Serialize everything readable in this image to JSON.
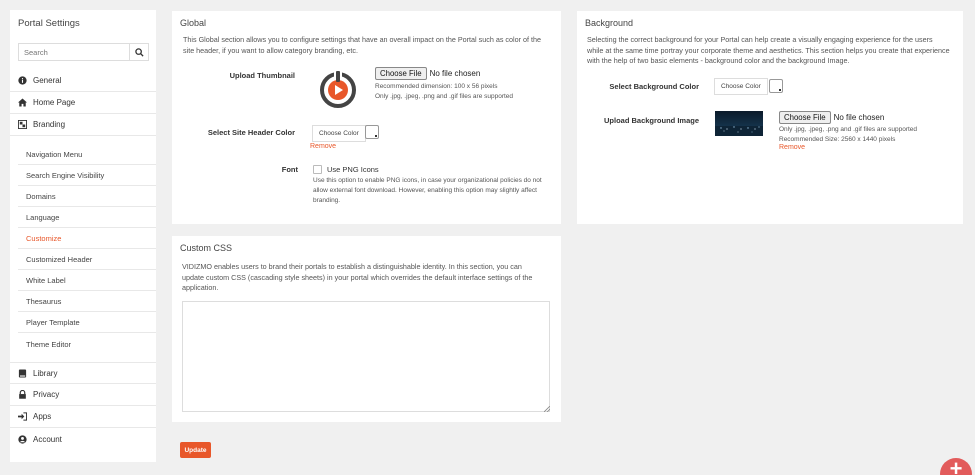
{
  "sidebar": {
    "title": "Portal Settings",
    "search_placeholder": "Search",
    "items": {
      "general": "General",
      "home_page": "Home Page",
      "branding": "Branding",
      "library": "Library",
      "privacy": "Privacy",
      "apps": "Apps",
      "account": "Account"
    },
    "branding_sub": {
      "navigation_menu": "Navigation Menu",
      "seo": "Search Engine Visibility",
      "domains": "Domains",
      "language": "Language",
      "customize": "Customize",
      "customized_header": "Customized Header",
      "white_label": "White Label",
      "thesaurus": "Thesaurus",
      "player_template": "Player Template",
      "theme_editor": "Theme Editor"
    },
    "active_item": "Customize"
  },
  "global": {
    "title": "Global",
    "desc_line1": "This Global section allows you to configure settings that have an overall impact on the Portal such as color of the",
    "desc_line2": "site header, if you want to allow category branding, etc.",
    "upload_thumbnail_label": "Upload Thumbnail",
    "choose_file": "Choose File",
    "no_file": "No file chosen",
    "thumb_hint1": "Recommended dimension: 100 x 56 pixels",
    "thumb_hint2": "Only .jpg, .jpeg, .png and .gif files are supported",
    "header_color_label": "Select Site Header Color",
    "choose_color": "Choose Color",
    "remove": "Remove",
    "font_label": "Font",
    "use_png_icons": "Use PNG Icons",
    "font_hint1": "Use this option to enable PNG icons, in case your organizational policies do not",
    "font_hint2": "allow external font download. However, enabling this option may slightly affect",
    "font_hint3": "branding."
  },
  "background": {
    "title": "Background",
    "desc_line1": "Selecting the correct background for your Portal can help create a visually engaging experience for the users",
    "desc_line2": "while at the same time portray your corporate theme and aesthetics. This section helps you create that experience",
    "desc_line3": "with the help of two basic elements - background color and the background Image.",
    "bg_color_label": "Select Background Color",
    "choose_color": "Choose Color",
    "bg_image_label": "Upload Background Image",
    "choose_file": "Choose File",
    "no_file": "No file chosen",
    "image_hint1": "Only .jpg, .jpeg, .png and .gif files are supported",
    "image_hint2": "Recommended Size: 2560 x 1440 pixels",
    "remove": "Remove"
  },
  "custom_css": {
    "title": "Custom CSS",
    "desc_line1": "VIDIZMO enables users to brand their portals to establish a distinguishable identity. In this section, you can",
    "desc_line2": "update custom CSS (cascading style sheets) in your portal which overrides the default interface settings of the",
    "desc_line3": "application.",
    "value": ""
  },
  "update_label": "Update",
  "colors": {
    "accent": "#e8572a",
    "fab": "#e25b5b"
  }
}
